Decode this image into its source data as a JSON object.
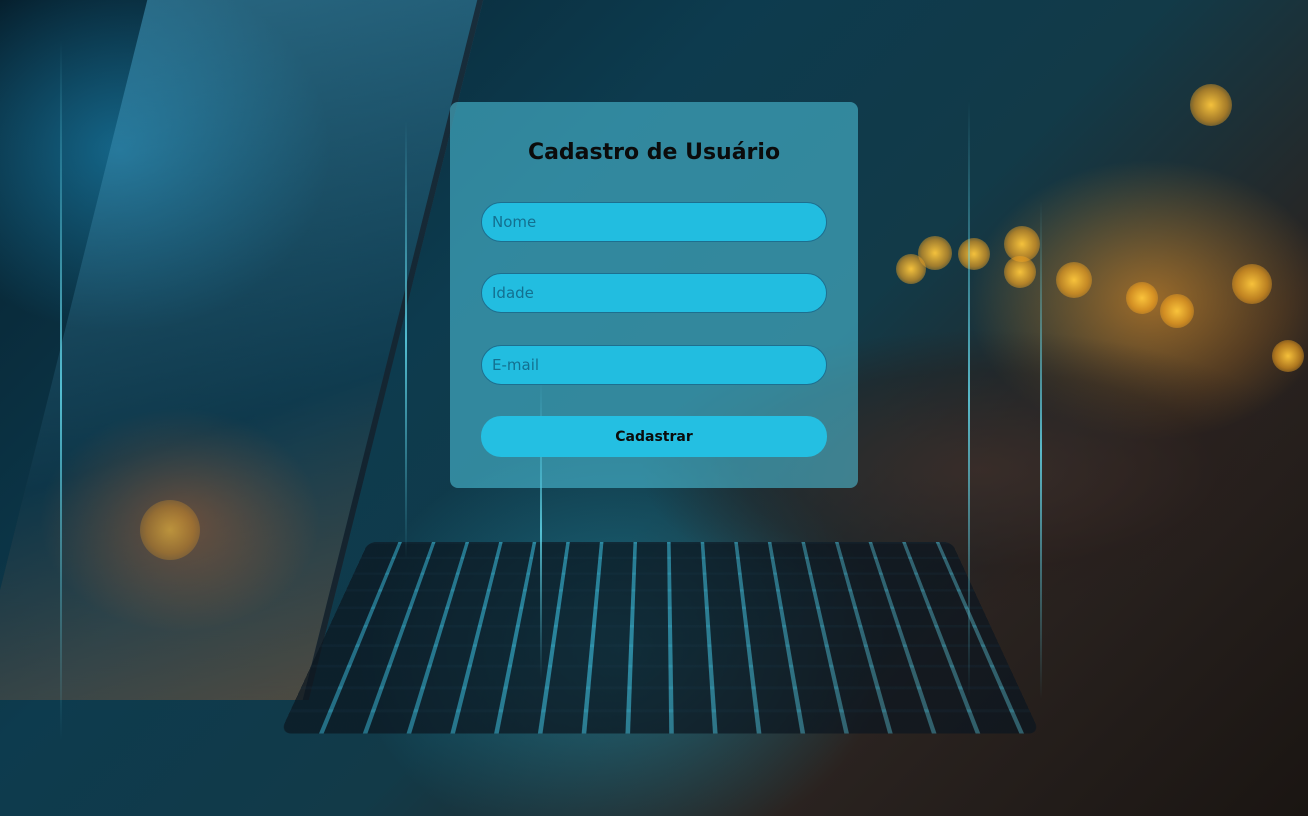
{
  "form": {
    "title": "Cadastro de Usuário",
    "fields": [
      {
        "placeholder": "Nome",
        "value": ""
      },
      {
        "placeholder": "Idade",
        "value": ""
      },
      {
        "placeholder": "E-mail",
        "value": ""
      }
    ],
    "submit_label": "Cadastrar"
  },
  "colors": {
    "card": "#50c8e1",
    "input_fill": "#22bde0",
    "button_fill": "#24bfe2",
    "title_text": "#0b0b0b"
  }
}
